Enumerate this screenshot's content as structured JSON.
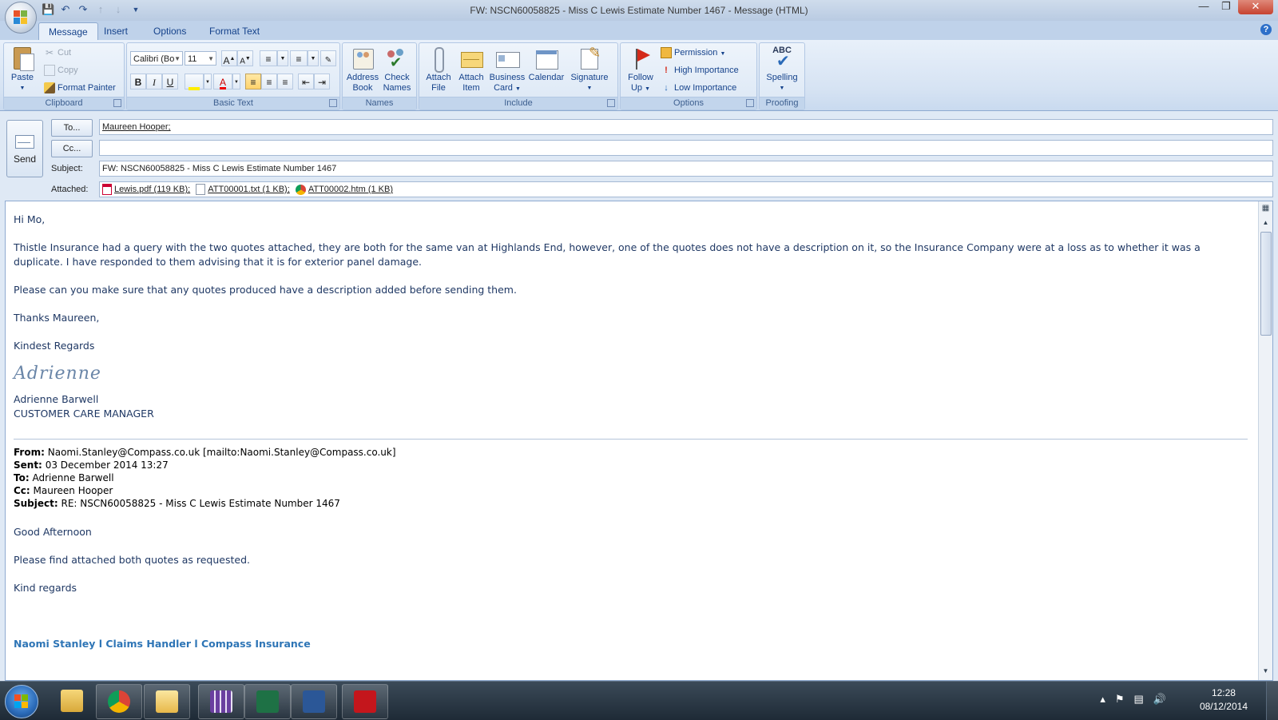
{
  "window": {
    "title": "FW: NSCN60058825 - Miss C Lewis Estimate Number 1467 - Message (HTML)",
    "buttons": [
      "minimize-icon",
      "restore-icon",
      "close-icon"
    ]
  },
  "quick_access": [
    "save-icon",
    "undo-icon",
    "redo-icon",
    "up-arrow-icon",
    "down-arrow-icon",
    "customize-icon"
  ],
  "ribbon": {
    "tabs": [
      "Message",
      "Insert",
      "Options",
      "Format Text"
    ],
    "active_tab": "Message",
    "groups": {
      "clipboard": {
        "label": "Clipboard",
        "paste": "Paste",
        "cut": "Cut",
        "copy": "Copy",
        "format_painter": "Format Painter"
      },
      "basic_text": {
        "label": "Basic Text",
        "font": "Calibri (Bo",
        "size": "11",
        "bold": "B",
        "italic": "I",
        "underline": "U",
        "grow": "A",
        "shrink": "A"
      },
      "names": {
        "label": "Names",
        "address_book": [
          "Address",
          "Book"
        ],
        "check_names": [
          "Check",
          "Names"
        ]
      },
      "include": {
        "label": "Include",
        "attach_file": [
          "Attach",
          "File"
        ],
        "attach_item": [
          "Attach",
          "Item"
        ],
        "business_card": [
          "Business",
          "Card"
        ],
        "calendar": "Calendar",
        "signature": "Signature"
      },
      "options": {
        "label": "Options",
        "follow_up": [
          "Follow",
          "Up"
        ],
        "permission": "Permission",
        "high_importance": "High Importance",
        "low_importance": "Low Importance"
      },
      "proofing": {
        "label": "Proofing",
        "spelling": "Spelling",
        "abc": "ABC"
      }
    }
  },
  "compose": {
    "send": "Send",
    "to_button": "To...",
    "cc_button": "Cc...",
    "to_value": "Maureen Hooper;",
    "cc_value": "",
    "subject_label": "Subject:",
    "subject_value": "FW: NSCN60058825 - Miss C Lewis Estimate Number 1467",
    "attached_label": "Attached:",
    "attachments": [
      {
        "name": "Lewis.pdf (119 KB);",
        "icon": "pdf-icon"
      },
      {
        "name": "ATT00001.txt (1 KB);",
        "icon": "text-file-icon"
      },
      {
        "name": "ATT00002.htm (1 KB)",
        "icon": "chrome-icon"
      }
    ]
  },
  "body": {
    "greeting": "Hi Mo,",
    "para1": "Thistle Insurance had a  query with the two quotes attached, they are both for the same van at Highlands End, however, one of the quotes does not have a description on it, so the Insurance Company were at a loss as to whether it was a duplicate.  I have responded to them advising that it is for exterior panel damage.",
    "para2": "Please can you make sure that any quotes produced have a description added before sending them.",
    "thanks": "Thanks Maureen,",
    "regards": "Kindest Regards",
    "signature": "Adrienne",
    "sender_name": "Adrienne Barwell",
    "sender_title": "CUSTOMER CARE MANAGER",
    "forward": {
      "from_label": "From:",
      "from": "Naomi.Stanley@Compass.co.uk [mailto:Naomi.Stanley@Compass.co.uk]",
      "sent_label": "Sent:",
      "sent": "03 December 2014 13:27",
      "to_label": "To:",
      "to": "Adrienne Barwell",
      "cc_label": "Cc:",
      "cc": "Maureen Hooper",
      "subject_label": "Subject:",
      "subject": "RE: NSCN60058825 - Miss C Lewis Estimate Number 1467"
    },
    "fw_greeting": "Good Afternoon",
    "fw_para": "Please find attached both quotes as requested.",
    "fw_regards": "Kind regards",
    "fw_footer": "Naomi Stanley l Claims Handler l Compass Insurance"
  },
  "taskbar": {
    "apps": [
      "explorer-icon",
      "chrome-icon",
      "outlook-icon",
      "calculator-icon",
      "excel-icon",
      "word-icon",
      "acrobat-icon"
    ],
    "time": "12:28",
    "date": "08/12/2014"
  },
  "colors": {
    "accent": "#15428b",
    "body_text": "#1f3864",
    "footer_link": "#2e75b6"
  }
}
